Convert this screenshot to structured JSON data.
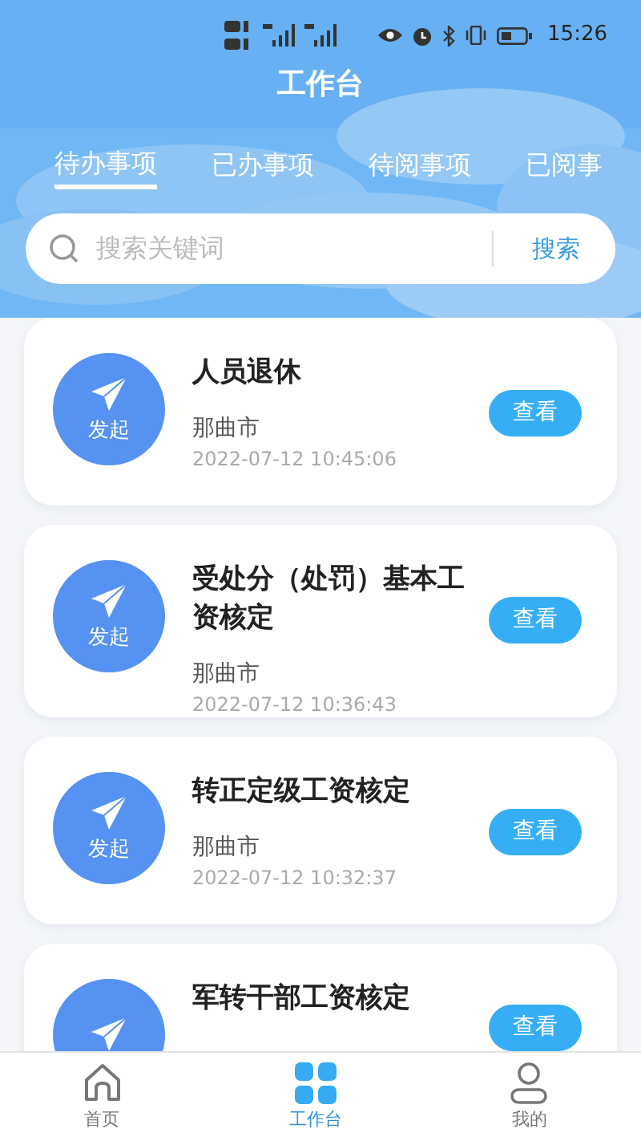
{
  "status_bar": {
    "time": "15:26"
  },
  "title": "工作台",
  "tabs": [
    {
      "label": "待办事项",
      "selected": true
    },
    {
      "label": "已办事项",
      "selected": false
    },
    {
      "label": "待阅事项",
      "selected": false
    },
    {
      "label": "已阅事",
      "selected": false
    }
  ],
  "search": {
    "placeholder": "搜索关键词",
    "button": "搜索"
  },
  "items": [
    {
      "badge": "发起",
      "title": "人员退休",
      "place": "那曲市",
      "time": "2022-07-12 10:45:06",
      "button": "查看"
    },
    {
      "badge": "发起",
      "title": "受处分（处罚）基本工资核定",
      "place": "那曲市",
      "time": "2022-07-12 10:36:43",
      "button": "查看"
    },
    {
      "badge": "发起",
      "title": "转正定级工资核定",
      "place": "那曲市",
      "time": "2022-07-12 10:32:37",
      "button": "查看"
    },
    {
      "title": "军转干部工资核定",
      "button": "查看"
    }
  ],
  "nav": [
    {
      "kind": "home",
      "label": "首页",
      "selected": false
    },
    {
      "kind": "grid",
      "label": "工作台",
      "selected": true
    },
    {
      "kind": "user",
      "label": "我的",
      "selected": false
    }
  ]
}
